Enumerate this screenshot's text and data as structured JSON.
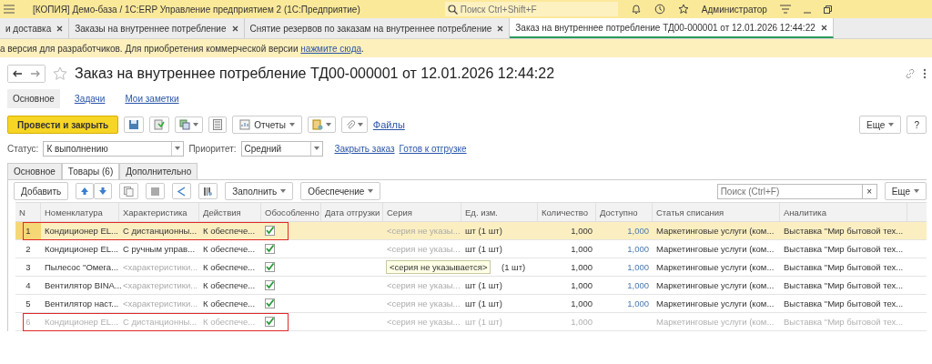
{
  "app_title": "[КОПИЯ] Демо-база / 1С:ERP Управление предприятием 2  (1С:Предприятие)",
  "search": {
    "placeholder": "Поиск Ctrl+Shift+F"
  },
  "user": "Администратор",
  "tabs": [
    {
      "label": "и доставка",
      "selected": false
    },
    {
      "label": "Заказы на внутреннее потребление",
      "selected": false
    },
    {
      "label": "Снятие резервов по заказам на внутреннее потребление",
      "selected": false
    },
    {
      "label": "Заказ на внутреннее потребление ТД00-000001 от 12.01.2026 12:44:22",
      "selected": true
    }
  ],
  "banner": {
    "text": "а версия для разработчиков. Для приобретения коммерческой версии",
    "link": "нажмите сюда",
    "end": "."
  },
  "title": "Заказ на внутреннее потребление ТД00-000001 от 12.01.2026 12:44:22",
  "sections": [
    {
      "label": "Основное",
      "selected": true
    },
    {
      "label": "Задачи",
      "selected": false
    },
    {
      "label": "Мои заметки",
      "selected": false
    }
  ],
  "toolbar": {
    "primary": "Провести и закрыть",
    "reports": "Отчеты",
    "files": "Файлы",
    "more": "Еще",
    "help": "?"
  },
  "status": {
    "label": "Статус:",
    "value": "К выполнению",
    "priority_label": "Приоритет:",
    "priority": "Средний",
    "links": [
      "Закрыть заказ",
      "Готов к отгрузке"
    ]
  },
  "form_tabs": [
    {
      "label": "Основное",
      "selected": false
    },
    {
      "label": "Товары (6)",
      "selected": true
    },
    {
      "label": "Дополнительно",
      "selected": false
    }
  ],
  "table_toolbar": {
    "add": "Добавить",
    "fill": "Заполнить",
    "supply": "Обеспечение",
    "search_placeholder": "Поиск (Ctrl+F)",
    "clear": "×",
    "more": "Еще"
  },
  "table": {
    "columns": [
      "N",
      "Номенклатура",
      "Характеристика",
      "Действия",
      "Обособленно",
      "Дата отгрузки",
      "Серия",
      "Ед. изм.",
      "Количество",
      "Доступно",
      "Статья списания",
      "Аналитика"
    ],
    "rows": [
      {
        "n": "1",
        "item": "Кондиционер EL...",
        "char": "С дистанционны...",
        "char_placeholder": false,
        "action": "К обеспече...",
        "separate": true,
        "series": "<серия не указы...",
        "unit": "шт (1 шт)",
        "qty": "1,000",
        "avail": "1,000",
        "article": "Маркетинговые услуги (ком...",
        "analytics": "Выставка \"Мир бытовой тех...",
        "selected": true,
        "disabled": false,
        "highlighted": true
      },
      {
        "n": "2",
        "item": "Кондиционер EL...",
        "char": "С ручным управ...",
        "char_placeholder": false,
        "action": "К обеспече...",
        "separate": true,
        "series": "<серия не указы...",
        "unit": "шт (1 шт)",
        "qty": "1,000",
        "avail": "1,000",
        "article": "Маркетинговые услуги (ком...",
        "analytics": "Выставка \"Мир бытовой тех...",
        "selected": false,
        "disabled": false,
        "highlighted": false
      },
      {
        "n": "3",
        "item": "Пылесос \"Омега...",
        "char": "<характеристики...",
        "char_placeholder": true,
        "action": "К обеспече...",
        "separate": true,
        "tooltip": "<серия не указывается>",
        "unit": "(1 шт)",
        "qty": "1,000",
        "avail": "1,000",
        "article": "Маркетинговые услуги (ком...",
        "analytics": "Выставка \"Мир бытовой тех...",
        "selected": false,
        "disabled": false,
        "highlighted": false
      },
      {
        "n": "4",
        "item": "Вентилятор BINA...",
        "char": "<характеристики...",
        "char_placeholder": true,
        "action": "К обеспече...",
        "separate": true,
        "series": "<серия не указы...",
        "unit": "шт (1 шт)",
        "qty": "1,000",
        "avail": "1,000",
        "article": "Маркетинговые услуги (ком...",
        "analytics": "Выставка \"Мир бытовой тех...",
        "selected": false,
        "disabled": false,
        "highlighted": false
      },
      {
        "n": "5",
        "item": "Вентилятор наст...",
        "char": "<характеристики...",
        "char_placeholder": true,
        "action": "К обеспече...",
        "separate": true,
        "series": "<серия не указы...",
        "unit": "шт (1 шт)",
        "qty": "1,000",
        "avail": "1,000",
        "article": "Маркетинговые услуги (ком...",
        "analytics": "Выставка \"Мир бытовой тех...",
        "selected": false,
        "disabled": false,
        "highlighted": false
      },
      {
        "n": "6",
        "item": "Кондиционер EL...",
        "char": "С дистанционны...",
        "char_placeholder": false,
        "action": "К обеспече...",
        "separate": true,
        "series": "<серия не указы...",
        "unit": "шт (1 шт)",
        "qty": "1,000",
        "article": "Маркетинговые услуги (ком...",
        "analytics": "Выставка \"Мир бытовой тех...",
        "selected": false,
        "disabled": true,
        "highlighted": true
      }
    ]
  }
}
